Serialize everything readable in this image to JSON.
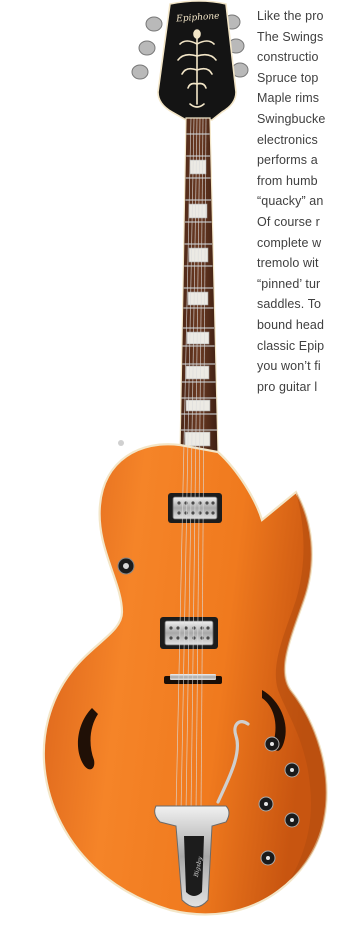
{
  "headstock_logo": "Epiphone",
  "tailpiece_logo": "Bigsby",
  "colors": {
    "body_orange": "#F07A1E",
    "body_shadow": "#C85510",
    "headstock_black": "#141414",
    "neck_wood": "#6b3a22",
    "chrome": "#C9C9C9",
    "binding_cream": "#F3E6C8"
  },
  "description_lines": [
    "Like the pro",
    "The Swings",
    "constructio",
    "Spruce top",
    "Maple rims",
    "Swingbucke",
    "electronics",
    "performs a",
    "from humb",
    "“quacky” an",
    "Of course r",
    "complete w",
    "tremolo wit",
    "“pinned’ tur",
    "saddles. To",
    "bound head",
    "classic Epip",
    "you won’t fi",
    "pro guitar l"
  ]
}
